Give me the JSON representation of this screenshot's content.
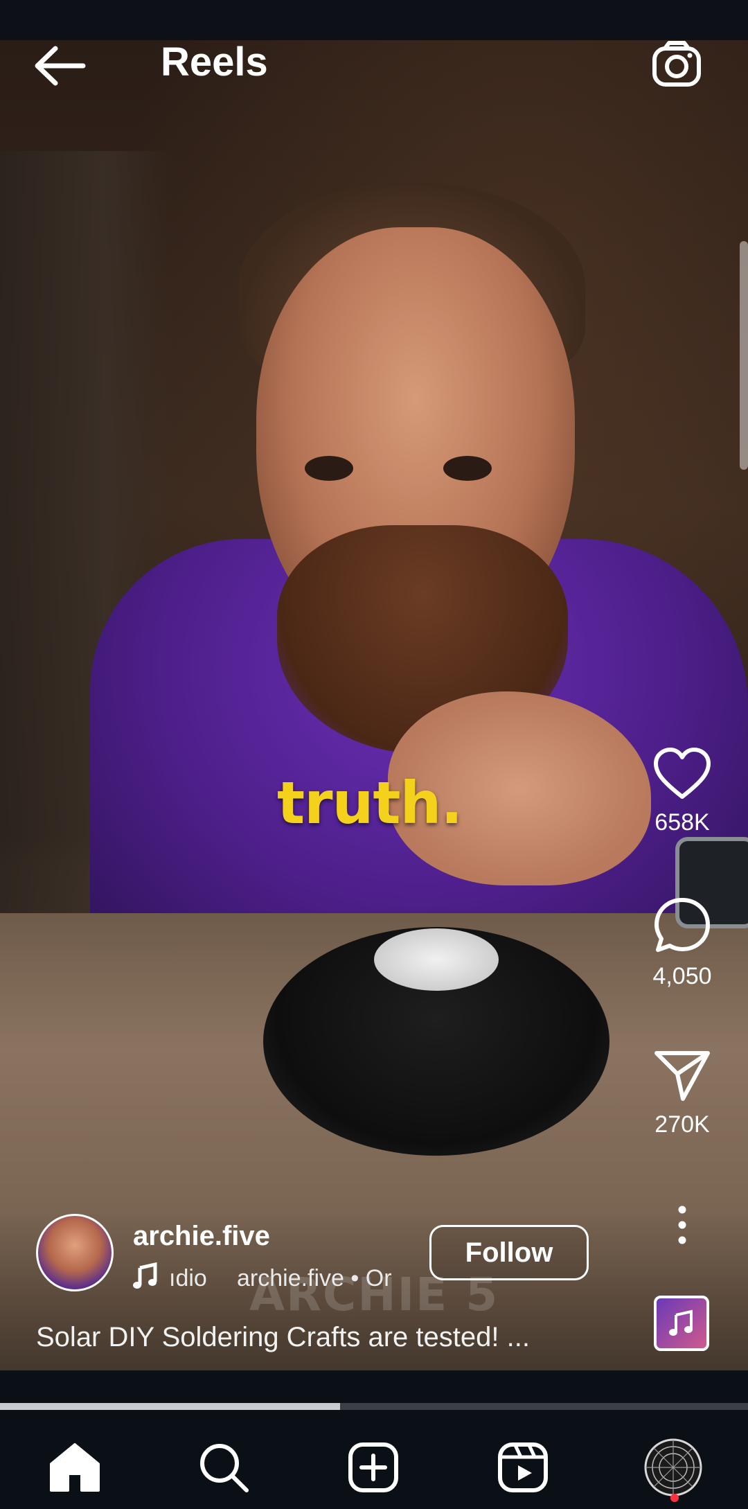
{
  "header": {
    "title": "Reels"
  },
  "video": {
    "caption_overlay": "truth.",
    "watermark": "ARCHIE 5"
  },
  "actions": {
    "likes": "658K",
    "comments": "4,050",
    "shares": "270K"
  },
  "author": {
    "username": "archie.five",
    "audio_label": "ıdio",
    "audio_source": "archie.five • Or",
    "follow_label": "Follow"
  },
  "caption": "Solar DIY Soldering Crafts are tested! ...",
  "progress": 0.455,
  "nav": {
    "items": [
      "home-icon",
      "search-icon",
      "create-icon",
      "reels-icon",
      "profile-avatar"
    ],
    "active": "home"
  },
  "colors": {
    "caption_yellow": "#f4d21b",
    "notification_red": "#ff3040"
  }
}
